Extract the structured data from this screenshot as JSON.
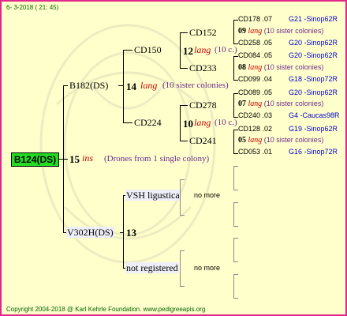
{
  "header": {
    "date": "6- 3-2018 ( 21: 45)"
  },
  "footer": {
    "copyright": "Copyright 2004-2018 @ Karl Kehrle Foundation.   www.pedigreeapis.org"
  },
  "root": {
    "id": "B124(DS)",
    "gen": "15",
    "mating": "ins",
    "note": "(Drones from 1 single colony)"
  },
  "sire": {
    "id": "B182(DS)",
    "gen": "14",
    "mating": "lang",
    "note": "(10 sister colonies)"
  },
  "dam": {
    "id": "V302H(DS)",
    "gen": "13"
  },
  "gen3": {
    "cd150": {
      "id": "CD150",
      "gen": "12",
      "mating": "lang",
      "note": "(10 c.)"
    },
    "cd224": {
      "id": "CD224",
      "gen": "10",
      "mating": "lang",
      "note": "(10 c.)"
    },
    "vsh": {
      "id": "VSH ligustica",
      "more": "no more"
    },
    "notreg": {
      "id": "not registered",
      "more": "no more"
    }
  },
  "gen4": {
    "cd152": {
      "id": "CD152",
      "gen": "09",
      "mating": "lang",
      "note": "(10 sister colonies)"
    },
    "cd233": {
      "id": "CD233",
      "gen": "08",
      "mating": "lang",
      "note": "(10 sister colonies)"
    },
    "cd278": {
      "id": "CD278",
      "gen": "07",
      "mating": "lang",
      "note": "(10 sister colonies)"
    },
    "cd241": {
      "id": "CD241",
      "gen": "05",
      "mating": "lang",
      "note": "(10 sister colonies)"
    }
  },
  "gen5": [
    {
      "id": "CD178",
      "gen": ".07",
      "line": "G21 -Sinop62R"
    },
    {
      "id": "CD258",
      "gen": ".05",
      "line": "G20 -Sinop62R"
    },
    {
      "id": "CD084",
      "gen": ".05",
      "line": "G20 -Sinop62R"
    },
    {
      "id": "CD099",
      "gen": ".04",
      "line": "G18 -Sinop72R"
    },
    {
      "id": "CD089",
      "gen": ".05",
      "line": "G20 -Sinop62R"
    },
    {
      "id": "CD240",
      "gen": ".03",
      "line": "G4 -Caucas98R"
    },
    {
      "id": "CD128",
      "gen": ".02",
      "line": "G19 -Sinop62R"
    },
    {
      "id": "CD053",
      "gen": ".01",
      "line": "G16 -Sinop72R"
    }
  ],
  "colors": {
    "border": "#e0288c",
    "background": "#ffffcc",
    "root_box": "#22dd22",
    "mating": "#cc0000",
    "note": "#6a2a8c",
    "line": "#0000cc",
    "footer": "#006600"
  }
}
